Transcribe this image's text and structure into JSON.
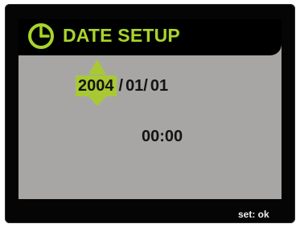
{
  "header": {
    "icon": "clock-icon",
    "title": "DATE SETUP"
  },
  "date": {
    "year": "2004",
    "separator_1": "/",
    "month": "01/",
    "day": "01",
    "selected_field": "year"
  },
  "time": {
    "value": "00:00"
  },
  "footer": {
    "hint": "set: ok"
  },
  "colors": {
    "accent": "#a9c934",
    "title_text": "#a9d42b",
    "screen_bg": "#a8a6a4",
    "bezel": "#050505",
    "text": "#141414"
  }
}
